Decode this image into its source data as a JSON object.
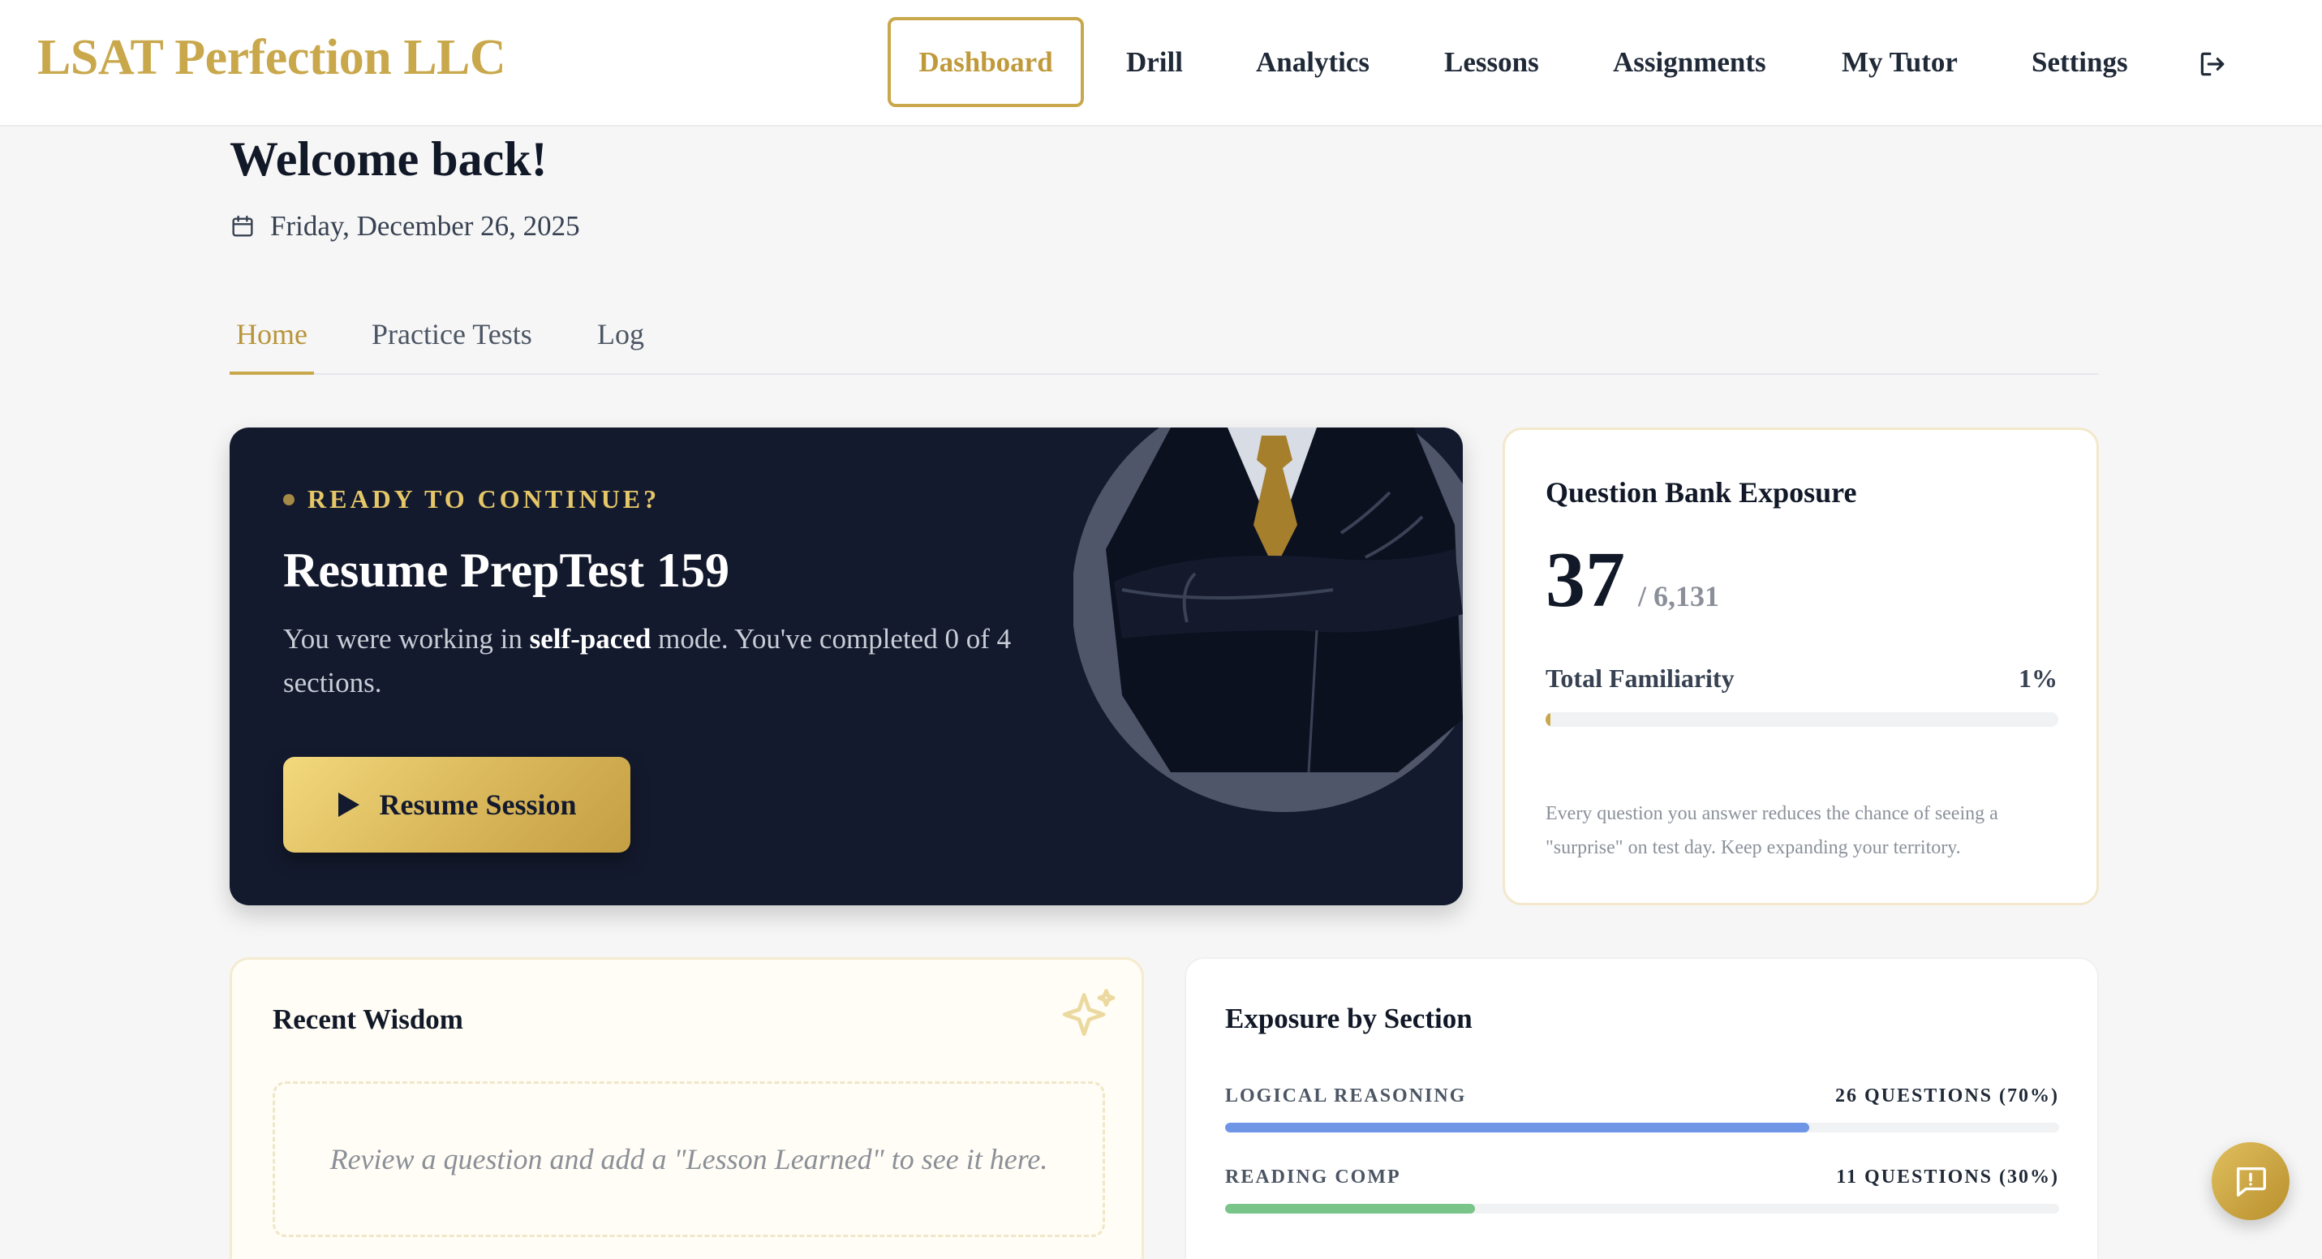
{
  "brand": {
    "name": "LSAT Perfection LLC",
    "color": "#c9a84c"
  },
  "nav": {
    "active": "Dashboard",
    "items": [
      "Drill",
      "Analytics",
      "Lessons",
      "Assignments",
      "My Tutor",
      "Settings"
    ],
    "logout_icon": "logout-icon"
  },
  "header": {
    "welcome": "Welcome back!",
    "date": "Friday, December 26, 2025",
    "date_icon": "calendar-icon"
  },
  "tabs": [
    "Home",
    "Practice Tests",
    "Log"
  ],
  "hero": {
    "eyebrow": "READY TO CONTINUE?",
    "title": "Resume PrepTest 159",
    "desc_prefix": "You were working in ",
    "desc_mode": "self-paced",
    "desc_suffix": " mode. You've completed 0 of 4 sections.",
    "button_label": "Resume Session",
    "button_icon": "play-icon",
    "art": "businessman-illustration"
  },
  "question_bank": {
    "title": "Question Bank Exposure",
    "count": "37",
    "total": "/ 6,131",
    "familiarity_label": "Total Familiarity",
    "familiarity_pct_text": "1%",
    "familiarity_value": 0.01,
    "note": "Every question you answer reduces the chance of seeing a \"surprise\" on test day. Keep expanding your territory."
  },
  "wisdom": {
    "title": "Recent Wisdom",
    "icon": "sparkle-icon",
    "empty_text": "Review a question and add a \"Lesson Learned\" to see it here."
  },
  "exposure": {
    "title": "Exposure by Section",
    "sections": [
      {
        "name": "LOGICAL REASONING",
        "count": "26 QUESTIONS (70%)",
        "value": 0.7,
        "color": "#6f96e6"
      },
      {
        "name": "READING COMP",
        "count": "11 QUESTIONS (30%)",
        "value": 0.3,
        "color": "#79c488"
      }
    ]
  },
  "chat": {
    "icon": "chat-icon"
  }
}
